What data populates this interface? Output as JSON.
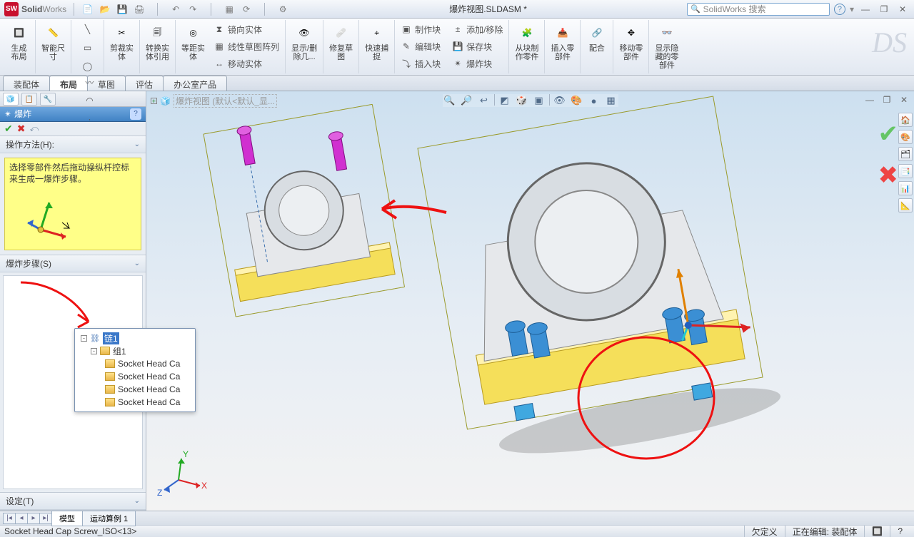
{
  "app": {
    "brand": "SolidWorks",
    "logo": "SW"
  },
  "title": "爆炸视图.SLDASM *",
  "search": {
    "placeholder": "SolidWorks 搜索"
  },
  "qat": {
    "new": "新建",
    "open": "打开",
    "save": "保存",
    "print": "打印",
    "undo": "撤销",
    "redo": "重做",
    "rebuild": "重建",
    "options": "选项"
  },
  "ribbon": {
    "g1": {
      "btn1": "生成\n布局",
      "btn2": "智能尺\n寸"
    },
    "g2": {
      "r1": "线",
      "r2": "矩形",
      "r3": "圆",
      "r4": "样条",
      "r5": "点"
    },
    "g3": {
      "btn1": "剪裁实\n体",
      "btn2": "转换实\n体引用",
      "btn3": "等距实\n体",
      "s1": "镜向实体",
      "s2": "线性草图阵列",
      "s3": "移动实体"
    },
    "g4": {
      "btn1": "显示/删\n除几...",
      "btn2": "修复草\n图",
      "btn3": "快速捕\n捉"
    },
    "g5": {
      "s1": "制作块",
      "s2": "编辑块",
      "s3": "插入块",
      "s4": "添加/移除",
      "s5": "保存块",
      "s6": "爆炸块"
    },
    "g6": {
      "btn1": "从块制\n作零件",
      "btn2": "插入零\n部件",
      "btn3": "配合",
      "btn4": "移动零\n部件",
      "btn5": "显示隐\n藏的零\n部件"
    }
  },
  "tabs": [
    "装配体",
    "布局",
    "草图",
    "评估",
    "办公室产品"
  ],
  "tabs_active": 1,
  "mgr_tabs": [
    "🧊",
    "📋",
    "🔧"
  ],
  "pm": {
    "title": "爆炸",
    "sec_how": "操作方法(H):",
    "hint": "选择零部件然后拖动操纵杆控标来生成一爆炸步骤。",
    "sec_steps": "爆炸步骤(S)",
    "sec_set": "设定(T)"
  },
  "tree": {
    "root": "链1",
    "group": "组1",
    "items": [
      "Socket Head Ca",
      "Socket Head Ca",
      "Socket Head Ca",
      "Socket Head Ca"
    ]
  },
  "crumb": "爆炸视图  (默认<默认_显...",
  "bottom_tabs": [
    "模型",
    "运动算例 1"
  ],
  "status": {
    "left": "Socket Head Cap Screw_ISO<13>",
    "r1": "欠定义",
    "r2": "正在编辑: 装配体"
  },
  "side_icons": [
    "🏠",
    "🧊",
    "🗂",
    "📑",
    "📊",
    "📐"
  ],
  "axes": {
    "x": "X",
    "y": "Y",
    "z": "Z"
  }
}
